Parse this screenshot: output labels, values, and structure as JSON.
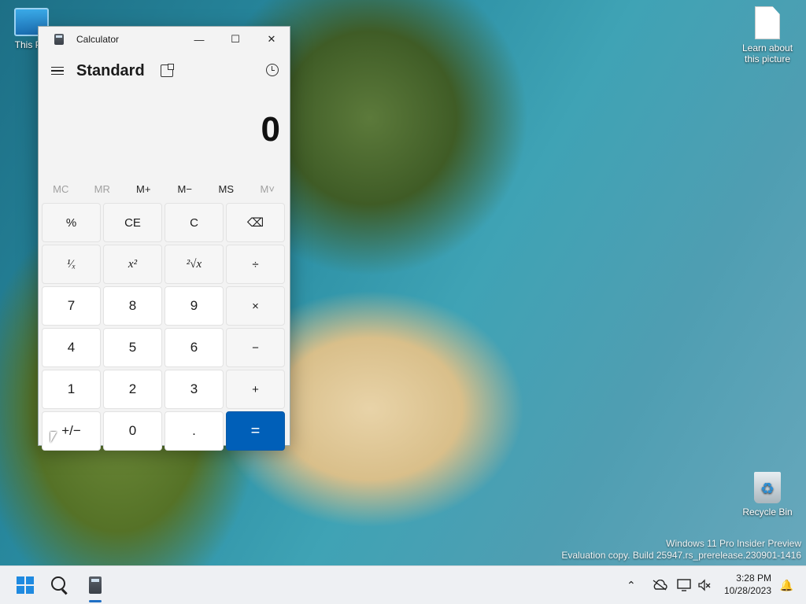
{
  "desktop": {
    "icons": [
      {
        "label": "This PC"
      },
      {
        "label": "Learn about this picture"
      },
      {
        "label": "Recycle Bin"
      }
    ],
    "watermark": {
      "line1": "Windows 11 Pro Insider Preview",
      "line2": "Evaluation copy. Build 25947.rs_prerelease.230901-1416"
    }
  },
  "calculator": {
    "title": "Calculator",
    "mode": "Standard",
    "display": "0",
    "window_buttons": {
      "minimize": "—",
      "maximize": "☐",
      "close": "✕"
    },
    "memory": [
      "MC",
      "MR",
      "M+",
      "M−",
      "MS",
      "M˅"
    ],
    "keys": [
      "%",
      "CE",
      "C",
      "⌫",
      "¹⁄ₓ",
      "x²",
      "²√x",
      "÷",
      "7",
      "8",
      "9",
      "×",
      "4",
      "5",
      "6",
      "−",
      "1",
      "2",
      "3",
      "+",
      "+/−",
      "0",
      ".",
      "="
    ]
  },
  "taskbar": {
    "tray_icons": [
      "chevron-up-icon",
      "onedrive-icon",
      "display-icon",
      "volume-muted-icon",
      "notification-icon"
    ],
    "time": "3:28 PM",
    "date": "10/28/2023",
    "chevron": "⌃"
  },
  "colors": {
    "accent": "#005fb8",
    "window_bg": "#f3f3f3",
    "taskbar_bg": "#eef0f3"
  }
}
